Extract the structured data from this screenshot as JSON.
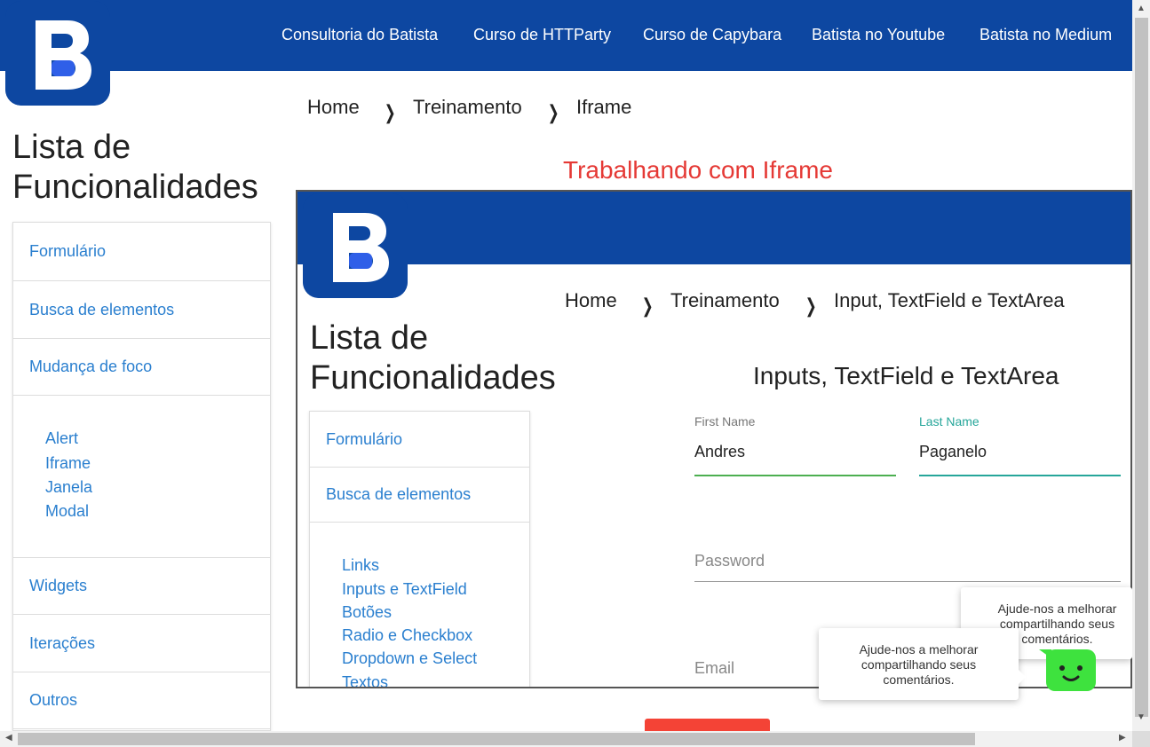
{
  "header": {
    "nav": [
      "Consultoria do Batista",
      "Curso de HTTParty",
      "Curso de Capybara",
      "Batista no Youtube",
      "Batista no Medium"
    ],
    "logo_letter": "B"
  },
  "breadcrumb": [
    "Home",
    "Treinamento",
    "Iframe"
  ],
  "sidebar": {
    "title_line1": "Lista de",
    "title_line2": "Funcionalidades",
    "items": [
      "Formulário",
      "Busca de elementos",
      "Mudança de foco",
      "Widgets",
      "Iterações",
      "Outros"
    ],
    "subitems": [
      "Alert",
      "Iframe",
      "Janela",
      "Modal"
    ]
  },
  "page_title": "Trabalhando com Iframe",
  "iframe": {
    "logo_letter": "B",
    "breadcrumb": [
      "Home",
      "Treinamento",
      "Input, TextField e TextArea"
    ],
    "sidebar": {
      "title_line1": "Lista de",
      "title_line2": "Funcionalidades",
      "items": [
        "Formulário",
        "Busca de elementos"
      ],
      "subitems": [
        "Links",
        "Inputs e TextField",
        "Botões",
        "Radio e Checkbox",
        "Dropdown e Select",
        "Textos"
      ]
    },
    "form_title": "Inputs, TextField e TextArea",
    "first_name": {
      "label": "First Name",
      "value": "Andres"
    },
    "last_name": {
      "label": "Last Name",
      "value": "Paganelo"
    },
    "password": {
      "placeholder": "Password"
    },
    "email": {
      "placeholder": "Email"
    }
  },
  "feedback": {
    "tooltip_text": "Ajude-nos a melhorar compartilhando seus comentários.",
    "tooltip_text_back": "Ajude-nos a melhorar compartilhando seus comentários."
  },
  "colors": {
    "brand_blue": "#0d47a1",
    "link_blue": "#2a7fcf",
    "title_red": "#e53935",
    "first_name_line": "#4caf50",
    "last_name_line": "#26a69a",
    "bot_green": "#3ee23e"
  }
}
